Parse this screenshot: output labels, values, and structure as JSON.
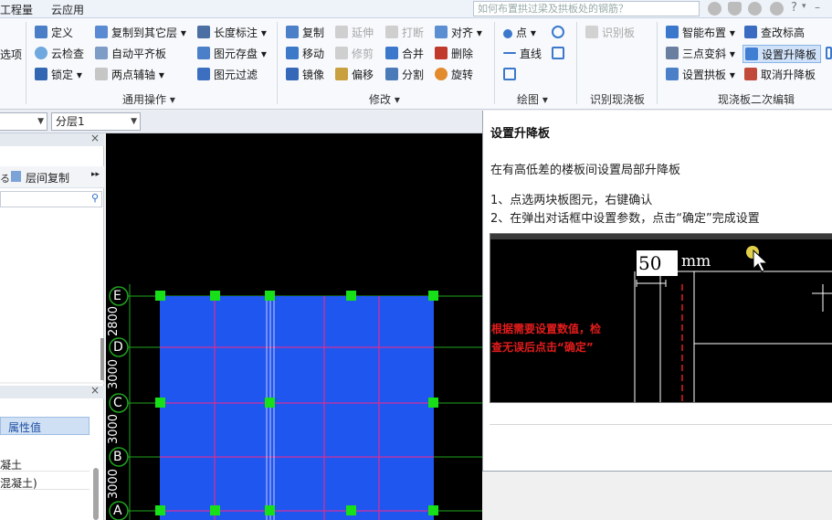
{
  "menu": {
    "items": [
      "工程量",
      "云应用"
    ],
    "search_placeholder": "如何布置拱过梁及拱板处的钢筋？"
  },
  "ribbon": {
    "left_partial": "选项",
    "general": {
      "label": "通用操作",
      "items": [
        "定义",
        "云检查",
        "锁定",
        "复制到其它层",
        "自动平齐板",
        "两点辅轴",
        "长度标注",
        "图元存盘",
        "图元过滤"
      ]
    },
    "modify": {
      "label": "修改",
      "items": [
        "复制",
        "移动",
        "镜像",
        "延伸",
        "修剪",
        "偏移",
        "打断",
        "合并",
        "分割",
        "对齐",
        "删除",
        "旋转"
      ]
    },
    "draw": {
      "label": "绘图",
      "items": [
        "点",
        "直线"
      ]
    },
    "identify": {
      "label": "识别现浇板",
      "items": [
        "识别板"
      ]
    },
    "edit2": {
      "label": "现浇板二次编辑",
      "items": [
        "智能布置",
        "三点变斜",
        "设置拱板",
        "查改标高",
        "设置升降板",
        "取消升降板"
      ]
    }
  },
  "toolbar2": {
    "combo1": "",
    "combo2": "分层1"
  },
  "left_panel": {
    "floor_copy": "层间复制",
    "prop_header": "属性值",
    "prop_rows": [
      "凝土",
      "混凝土)"
    ]
  },
  "canvas": {
    "axis_labels": [
      "E",
      "D",
      "C",
      "B",
      "A"
    ],
    "dims": [
      "2800",
      "3000",
      "3000",
      "3000"
    ]
  },
  "tip": {
    "title": "设置升降板",
    "desc": "在有高低差的楼板间设置局部升降板",
    "step1": "1、点选两块板图元，右键确认",
    "step2": "2、在弹出对话框中设置参数，点击“确定”完成设置",
    "img_value": "50",
    "img_unit": "mm",
    "img_note_1": "根据需要设置数值，检",
    "img_note_2": "查无误后点击“确定”"
  },
  "colors": {
    "slab": "#1f56f0",
    "grid": "#d0309a",
    "handle": "#18e018",
    "axis": "#1fa31f"
  }
}
